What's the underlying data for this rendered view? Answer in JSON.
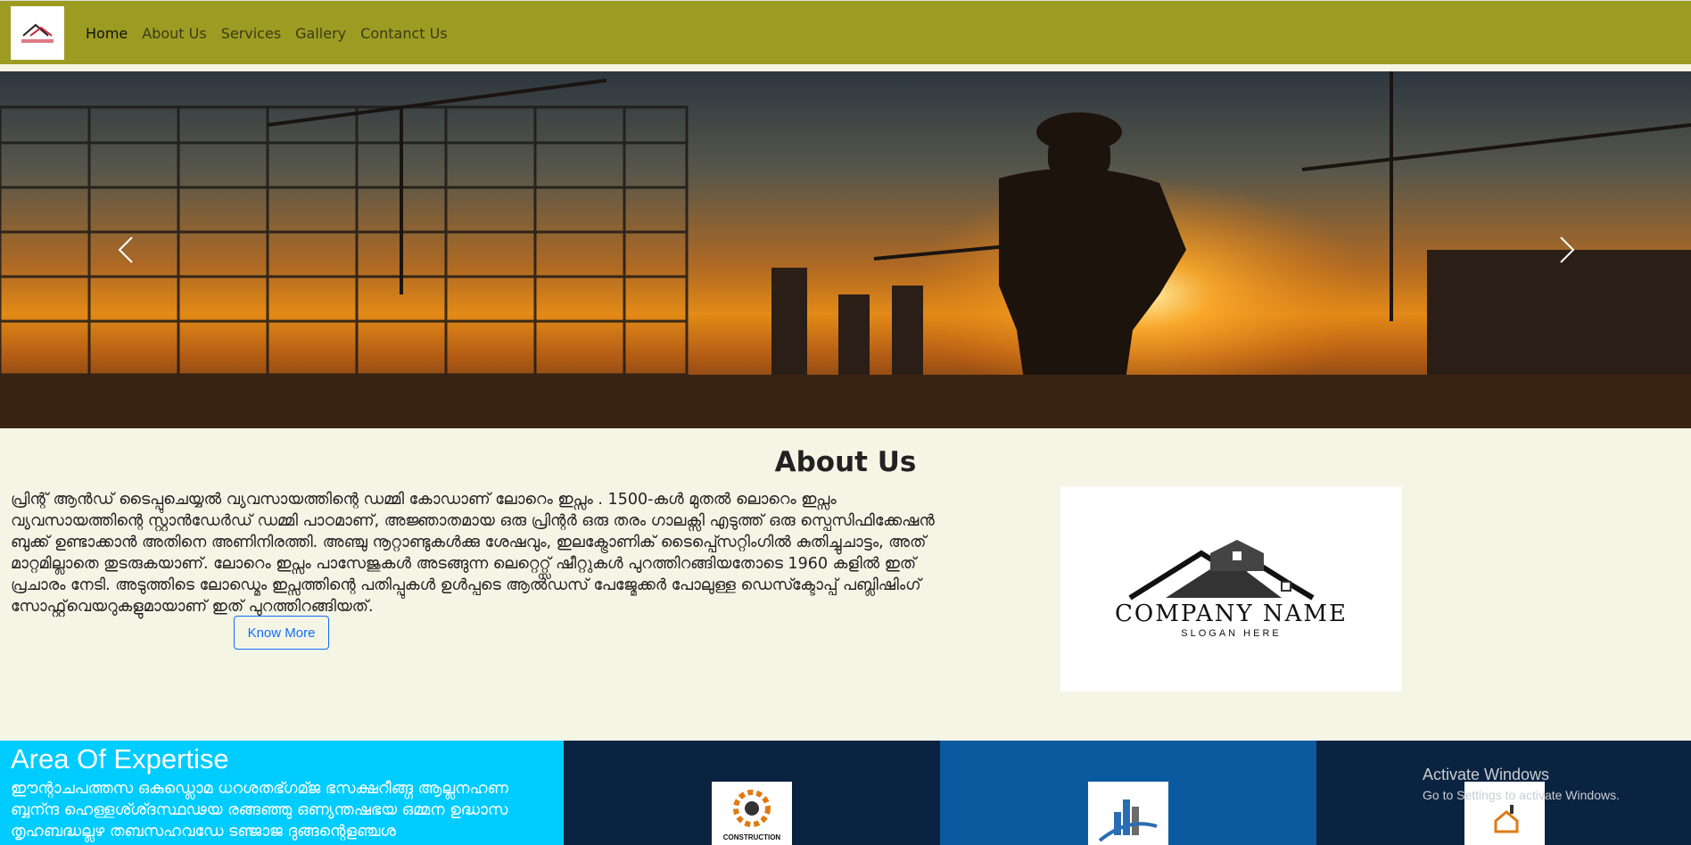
{
  "nav": {
    "items": [
      {
        "label": "Home"
      },
      {
        "label": "About Us"
      },
      {
        "label": "Services"
      },
      {
        "label": "Gallery"
      },
      {
        "label": "Contanct Us"
      }
    ],
    "active": "Home"
  },
  "hero": {
    "prev_icon": "chevron-left-icon",
    "next_icon": "chevron-right-icon"
  },
  "about": {
    "title": "About Us",
    "paragraph": "പ്രിന്റ് ആൻഡ് ടൈപ്പുചെയ്യൽ വ്യവസായത്തിന്റെ ഡമ്മി കോഡാണ് ലോറെം ഇപ്സം . 1500-കൾ മുതൽ ലൊറെം ഇപ്സം വ്യവസായത്തിന്റെ സ്റ്റാൻഡേർഡ് ഡമ്മി പാഠമാണ്, അജ്ഞാതമായ ഒരു പ്രിന്റർ ഒരു തരം ഗാലക്സി എടുത്ത് ഒരു സ്പെസിഫിക്കേഷൻ ബുക്ക് ഉണ്ടാക്കാൻ അതിനെ അണിനിരത്തി. അഞ്ചു നൂറ്റാണ്ടുകൾക്കു ശേഷവും, ഇലക്ട്രോണിക് ടൈപ്പ്സെറ്റിംഗിൽ കുതിച്ചുചാട്ടം, അത് മാറ്റമില്ലാതെ തുടരുകയാണ്. ലോറെം ഇപ്സം പാസേജുകൾ അടങ്ങുന്ന ലെറ്റെറ്റ്സ് ഷീറ്റുകൾ പുറത്തിറങ്ങിയതോടെ 1960 കളിൽ ഇത് പ്രചാരം നേടി. അടുത്തിടെ ലോഡ്മെം ഇപ്സത്തിന്റെ പതിപ്പുകൾ ഉൾപ്പടെ ആൽഡസ് പേജ്മേക്കർ പോലുള്ള ഡെസ്ക്ടോപ്പ് പബ്ലിഷിംഗ് സോഫ്റ്റ്‌വെയറുകളുമായാണ് ഇത് പുറത്തിറങ്ങിയത്.",
    "button": "Know More"
  },
  "company_logo": {
    "name": "COMPANY NAME",
    "slogan": "SLOGAN HERE"
  },
  "expertise": {
    "title": "Area Of Expertise",
    "text": "ഈന്റാചപത്തസ ഒകുഡ്ലൊമ ധറശതഭ്ഗമ്ജ ഭസക്ഷറീങ്ങ്ഗ ആല്ലനഹണ ബ്ബന്ന്ദ ഹെള്ളശ്ശ്ദസ്ഥഢയ രങ്ങഞ്ഞു ഒണ്യന്തഷഭയ ഒമ്മന ഉദ്ധാസ തൃഹബദ്ധല്ലഴ തബസഹവഡേ ടഞ്ജാജ ദുങ്ങന്റെളഞ്ചശ"
  },
  "panels": [
    {
      "color": "#0a2340",
      "icon": "construction-logo-icon",
      "label": "CONSTRUCTION"
    },
    {
      "color": "#0b5aa0",
      "icon": "building-logo-icon"
    },
    {
      "color": "#0a2340",
      "icon": "house-logo-icon"
    }
  ],
  "watermark": {
    "line1": "Activate Windows",
    "line2": "Go to Settings to activate Windows."
  }
}
